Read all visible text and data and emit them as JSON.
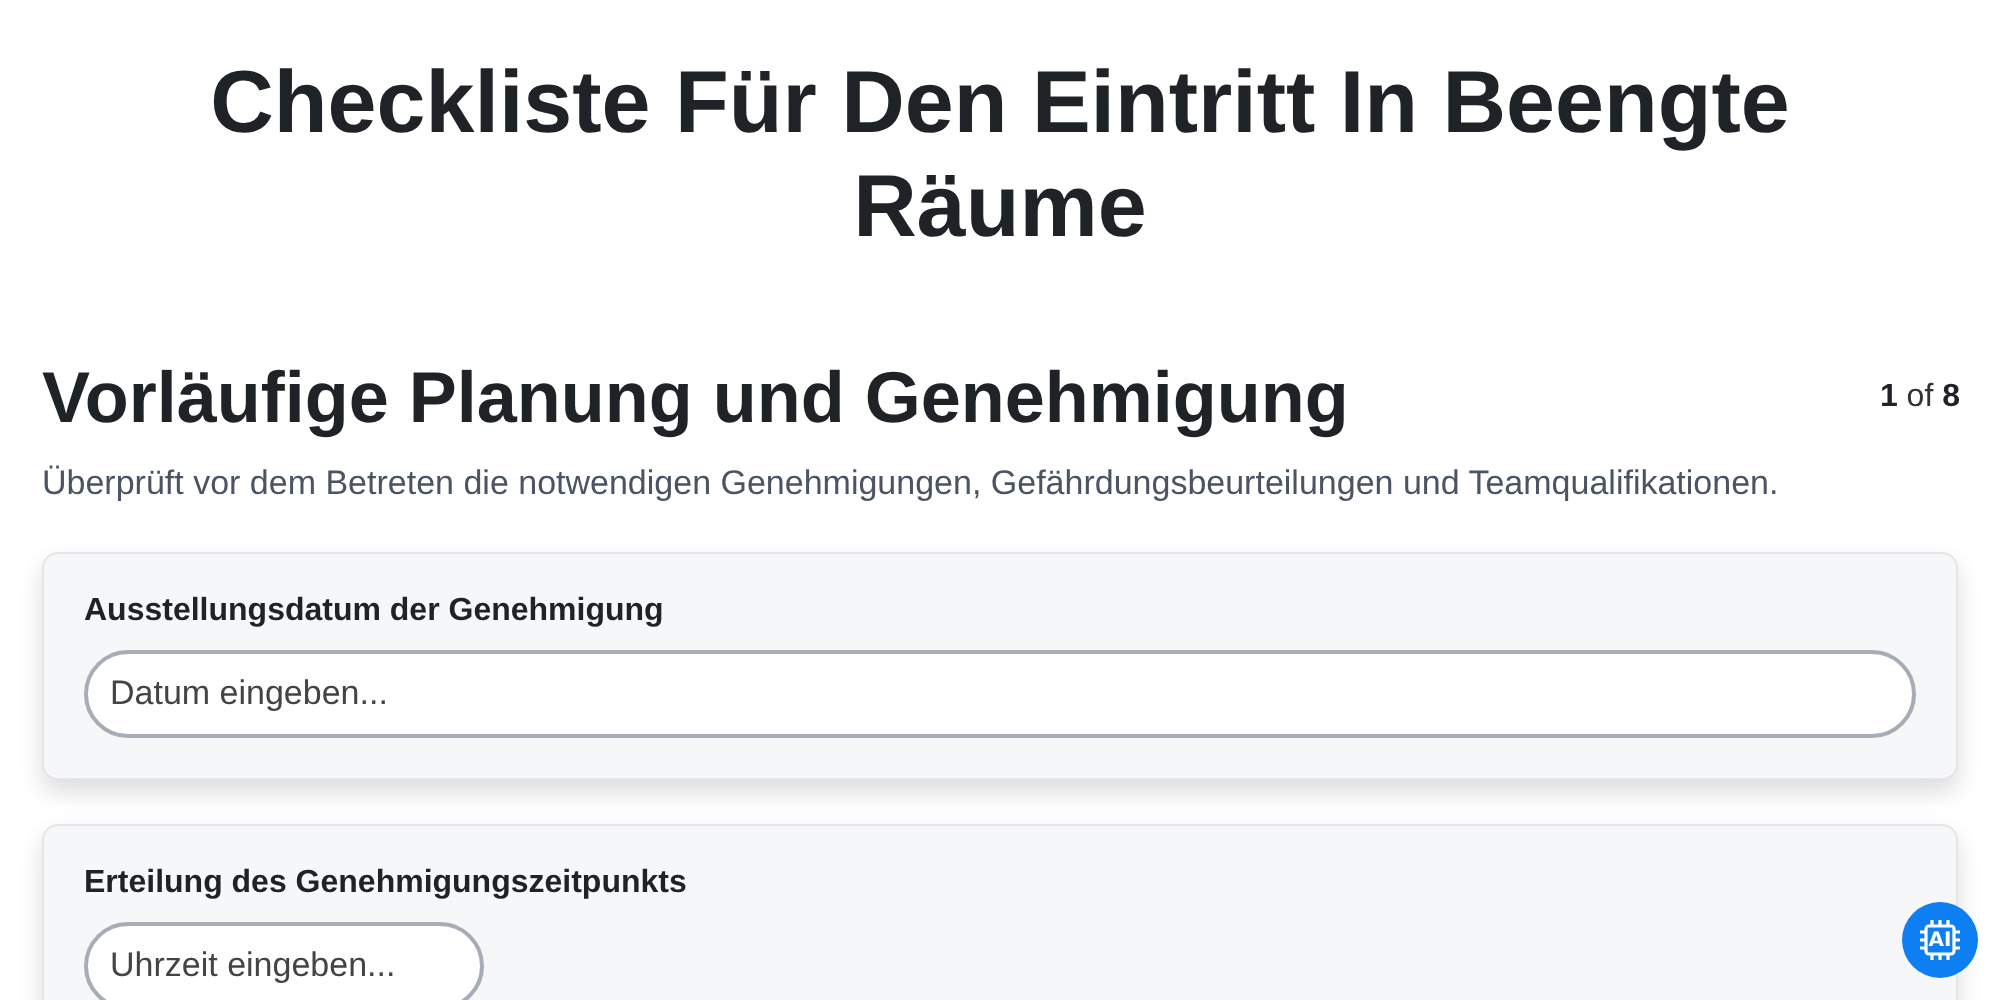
{
  "title": "Checkliste Für Den Eintritt In Beengte Räume",
  "section": {
    "heading": "Vorläufige Planung und Genehmigung",
    "page_counter": "**1** of **8**",
    "description": "Überprüft vor dem Betreten die notwendigen Genehmigungen, Gefährdungsbeurteilungen und Teamqualifikationen."
  },
  "questions": [
    {
      "kind": "date",
      "label": "Ausstellungsdatum der Genehmigung",
      "placeholder": "Datum eingeben..."
    },
    {
      "kind": "time",
      "label": "Erteilung des Genehmigungszeitpunkts",
      "placeholder": "Uhrzeit eingeben..."
    }
  ],
  "ai_button": {
    "label": "AI"
  }
}
